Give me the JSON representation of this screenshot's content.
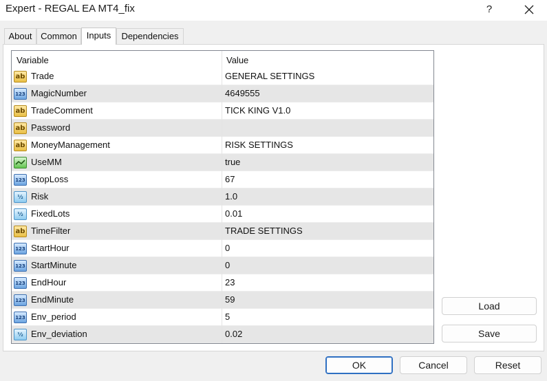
{
  "window": {
    "title": "Expert - REGAL EA MT4_fix",
    "help_label": "?",
    "close_icon": "close-icon"
  },
  "tabs": [
    {
      "label": "About",
      "active": false
    },
    {
      "label": "Common",
      "active": false
    },
    {
      "label": "Inputs",
      "active": true
    },
    {
      "label": "Dependencies",
      "active": false
    }
  ],
  "table": {
    "headers": {
      "variable": "Variable",
      "value": "Value"
    },
    "rows": [
      {
        "icon": "ab",
        "variable": "Trade",
        "value": "GENERAL SETTINGS"
      },
      {
        "icon": "123",
        "variable": "MagicNumber",
        "value": "4649555"
      },
      {
        "icon": "ab",
        "variable": "TradeComment",
        "value": "TICK KING V1.0"
      },
      {
        "icon": "ab",
        "variable": "Password",
        "value": ""
      },
      {
        "icon": "ab",
        "variable": "MoneyManagement",
        "value": "RISK SETTINGS"
      },
      {
        "icon": "bool",
        "variable": "UseMM",
        "value": "true"
      },
      {
        "icon": "123",
        "variable": "StopLoss",
        "value": "67"
      },
      {
        "icon": "half",
        "variable": "Risk",
        "value": "1.0"
      },
      {
        "icon": "half",
        "variable": "FixedLots",
        "value": "0.01"
      },
      {
        "icon": "ab",
        "variable": "TimeFilter",
        "value": "TRADE SETTINGS"
      },
      {
        "icon": "123",
        "variable": "StartHour",
        "value": "0"
      },
      {
        "icon": "123",
        "variable": "StartMinute",
        "value": "0"
      },
      {
        "icon": "123",
        "variable": "EndHour",
        "value": "23"
      },
      {
        "icon": "123",
        "variable": "EndMinute",
        "value": "59"
      },
      {
        "icon": "123",
        "variable": "Env_period",
        "value": "5"
      },
      {
        "icon": "half",
        "variable": "Env_deviation",
        "value": "0.02"
      }
    ]
  },
  "icon_text": {
    "ab": "ab",
    "123": "123",
    "half": "½"
  },
  "buttons": {
    "load": "Load",
    "save": "Save",
    "ok": "OK",
    "cancel": "Cancel",
    "reset": "Reset"
  },
  "colors": {
    "accent_ok_border": "#2e6fc2",
    "row_alt": "#e6e6e6",
    "window_bg": "#f0f0f0"
  }
}
